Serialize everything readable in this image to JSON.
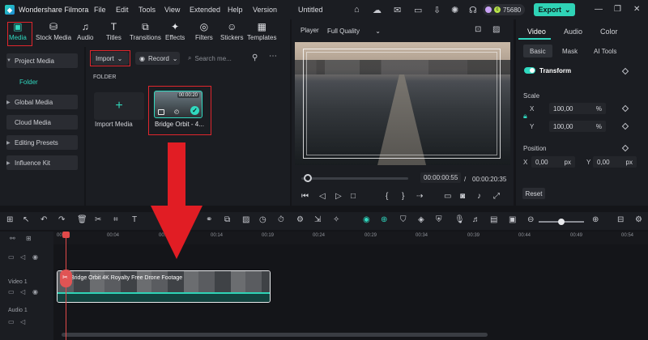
{
  "titlebar": {
    "app_name": "Wondershare Filmora",
    "menus": [
      "File",
      "Edit",
      "Tools",
      "View",
      "Extended",
      "Help",
      "Version"
    ],
    "project": "Untitled",
    "credits": "75680",
    "export_label": "Export"
  },
  "toolbar": {
    "items": [
      {
        "label": "Media",
        "icon": "media-icon",
        "active": true
      },
      {
        "label": "Stock Media",
        "icon": "stock-media-icon"
      },
      {
        "label": "Audio",
        "icon": "music-note-icon"
      },
      {
        "label": "Titles",
        "icon": "text-t-icon"
      },
      {
        "label": "Transitions",
        "icon": "transitions-icon"
      },
      {
        "label": "Effects",
        "icon": "effects-icon"
      },
      {
        "label": "Filters",
        "icon": "filters-icon"
      },
      {
        "label": "Stickers",
        "icon": "stickers-icon"
      },
      {
        "label": "Templates",
        "icon": "templates-icon"
      }
    ]
  },
  "leftnav": {
    "project_media": "Project Media",
    "folder": "Folder",
    "global_media": "Global Media",
    "cloud_media": "Cloud Media",
    "editing_presets": "Editing Presets",
    "influence_kit": "Influence Kit"
  },
  "media": {
    "import_label": "Import",
    "record_label": "Record",
    "search_placeholder": "Search me...",
    "folder_heading": "FOLDER",
    "import_media": "Import Media",
    "clip": {
      "name": "Bridge Orbit - 4...",
      "duration": "00:00:20"
    }
  },
  "player": {
    "label": "Player",
    "quality": "Full Quality",
    "current_time": "00:00:00:55",
    "total_time": "00:00:20:35"
  },
  "properties": {
    "tabs": [
      "Video",
      "Audio",
      "Color"
    ],
    "subtabs": [
      "Basic",
      "Mask",
      "AI Tools"
    ],
    "transform": "Transform",
    "scale": "Scale",
    "scale_x_label": "X",
    "scale_x": "100,00",
    "scale_y_label": "Y",
    "scale_y": "100,00",
    "scale_unit": "%",
    "position": "Position",
    "pos_x_label": "X",
    "pos_x": "0,00",
    "pos_y_label": "Y",
    "pos_y": "0,00",
    "pos_unit": "px",
    "reset": "Reset"
  },
  "timeline": {
    "ruler": [
      "00:00",
      "00:04",
      "00:09",
      "00:14",
      "00:19",
      "00:24",
      "00:29",
      "00:34",
      "00:39",
      "00:44",
      "00:49",
      "00:54"
    ],
    "video_track": "Video 1",
    "audio_track": "Audio 1",
    "clip_title": "Bridge Orbit   4K Royalty Free Drone Footage"
  },
  "colors": {
    "accent": "#2fd3b6",
    "annotation_red": "#e0262d",
    "playhead": "#e24a4a"
  }
}
